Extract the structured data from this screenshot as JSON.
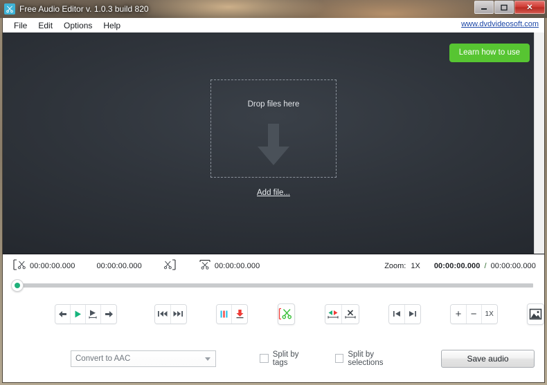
{
  "window": {
    "title": "Free Audio Editor v. 1.0.3 build 820",
    "app_icon": "scissors-icon",
    "minimize_label": "Minimize",
    "maximize_label": "Maximize",
    "close_label": "Close",
    "close_glyph": "✕"
  },
  "menubar": {
    "items": [
      {
        "label": "File"
      },
      {
        "label": "Edit"
      },
      {
        "label": "Options"
      },
      {
        "label": "Help"
      }
    ],
    "site_link": "www.dvdvideosoft.com"
  },
  "workspace": {
    "learn_button": "Learn how to use",
    "drop_label": "Drop files here",
    "drop_arrow_icon": "down-arrow-icon",
    "add_file_link": "Add file..."
  },
  "timebar": {
    "selection_start_icon": "cut-start-icon",
    "selection_start": "00:00:00.000",
    "selection_length": "00:00:00.000",
    "selection_end_icon": "cut-end-icon",
    "total_cut_icon": "cut-total-icon",
    "selection_total": "00:00:00.000",
    "zoom_label": "Zoom:",
    "zoom_value": "1X",
    "position_current": "00:00:00.000",
    "position_separator": "/",
    "position_total": "00:00:00.000"
  },
  "slider": {
    "name": "timeline-position-slider",
    "value": 0
  },
  "toolbar": {
    "groups": [
      {
        "name": "transport-group",
        "buttons": [
          {
            "name": "step-back-button",
            "icon": "arrow-left-icon"
          },
          {
            "name": "play-button",
            "icon": "play-icon",
            "color": "#15b47d"
          },
          {
            "name": "play-selection-button",
            "icon": "play-selection-icon"
          },
          {
            "name": "step-forward-button",
            "icon": "arrow-right-icon"
          }
        ]
      },
      {
        "name": "skip-group",
        "buttons": [
          {
            "name": "skip-previous-button",
            "icon": "skip-previous-icon"
          },
          {
            "name": "skip-next-button",
            "icon": "skip-next-icon"
          }
        ]
      },
      {
        "name": "marker-group",
        "buttons": [
          {
            "name": "add-tag-button",
            "icon": "tag-bars-icon"
          },
          {
            "name": "set-marker-button",
            "icon": "down-arrow-marker-icon"
          }
        ]
      },
      {
        "name": "cut-group",
        "buttons": [
          {
            "name": "cut-selection-button",
            "icon": "scissors-bracket-icon"
          }
        ]
      },
      {
        "name": "selection-group",
        "buttons": [
          {
            "name": "select-region-button",
            "icon": "select-region-icon"
          },
          {
            "name": "delete-region-button",
            "icon": "delete-region-icon"
          }
        ]
      },
      {
        "name": "edge-group",
        "buttons": [
          {
            "name": "go-to-start-button",
            "icon": "go-to-start-icon"
          },
          {
            "name": "go-to-end-button",
            "icon": "go-to-end-icon"
          }
        ]
      },
      {
        "name": "zoom-group",
        "buttons": [
          {
            "name": "zoom-in-button",
            "icon": "plus-icon",
            "label": "+"
          },
          {
            "name": "zoom-out-button",
            "icon": "minus-icon",
            "label": "−"
          },
          {
            "name": "zoom-reset-button",
            "icon": "zoom-1x-icon",
            "label": "1X"
          }
        ]
      },
      {
        "name": "image-group",
        "buttons": [
          {
            "name": "album-art-button",
            "icon": "picture-icon"
          }
        ]
      }
    ]
  },
  "bottombar": {
    "format_value": "Convert to AAC",
    "format_placeholder": "Convert to AAC",
    "split_by_tags_label": "Split by tags",
    "split_by_tags_checked": false,
    "split_by_selections_label": "Split by selections",
    "split_by_selections_checked": false,
    "save_button": "Save audio"
  },
  "colors": {
    "accent_green": "#57c532",
    "play_green": "#15b47d",
    "marker_red": "#ef3b36",
    "tag_cyan": "#2fc2e8",
    "link_blue": "#1b46a6",
    "workspace_dark": "#2f343b"
  }
}
